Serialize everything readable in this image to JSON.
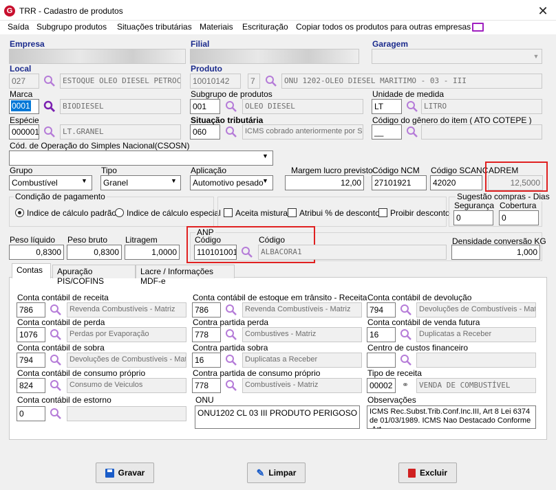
{
  "window": {
    "title": "TRR - Cadastro de produtos",
    "app_icon": "G"
  },
  "menu": {
    "items": [
      "Saída",
      "Subgrupo produtos",
      "Situações tributárias",
      "Materiais",
      "Escrituração",
      "Copiar todos os produtos para outras empresas"
    ]
  },
  "header": {
    "empresa_label": "Empresa",
    "filial_label": "Filial",
    "garagem_label": "Garagem",
    "local_label": "Local",
    "local_code": "027",
    "local_name": "ESTOQUE OLEO DIESEL PETROC",
    "produto_label": "Produto",
    "produto_code": "10010142",
    "produto_digit": "7",
    "produto_name": "ONU 1202-OLEO DIESEL MARITIMO - 03 - III",
    "marca_label": "Marca",
    "marca_code": "0001",
    "marca_name": "BIODIESEL",
    "subgrupo_label": "Subgrupo de produtos",
    "subgrupo_code": "001",
    "subgrupo_name": "OLEO DIESEL",
    "unidade_label": "Unidade de medida",
    "unidade_code": "LT",
    "unidade_name": "LITRO",
    "especie_label": "Espécie",
    "especie_code": "000001",
    "especie_name": "LT.GRANEL",
    "situacao_label": "Situação tributária",
    "situacao_code": "060",
    "situacao_name": "ICMS cobrado anteriormente por ST",
    "genero_label": "Código do gênero do item ( ATO COTEPE )",
    "genero_code": "__",
    "csosn_label": "Cód. de Operação do Simples Nacional(CSOSN)"
  },
  "classification": {
    "grupo_label": "Grupo",
    "grupo_value": "Combustível",
    "tipo_label": "Tipo",
    "tipo_value": "Granel",
    "aplicacao_label": "Aplicação",
    "aplicacao_value": "Automotivo pesado",
    "margem_label": "Margem lucro previsto",
    "margem_value": "12,00",
    "ncm_label": "Código NCM",
    "ncm_value": "27101921",
    "scanc_label": "Código SCANC",
    "scanc_value": "42020",
    "adrem_label": "ADREM",
    "adrem_value": "12,5000"
  },
  "payment": {
    "legend": "Condição de pagamento",
    "option1": "Indice de cálculo padrão",
    "option2": "Indice de cálculo especial",
    "aceita": "Aceita mistura",
    "atribui": "Atribui % de desconto",
    "proibir": "Proibir desconto"
  },
  "sugestao": {
    "legend": "Sugestão compras - Dias",
    "seguranca_label": "Segurança",
    "seguranca_value": "0",
    "cobertura_label": "Cobertura",
    "cobertura_value": "0"
  },
  "weights": {
    "peso_liquido_label": "Peso líquido",
    "peso_liquido_value": "0,8300",
    "peso_bruto_label": "Peso bruto",
    "peso_bruto_value": "0,8300",
    "litragem_label": "Litragem",
    "litragem_value": "1,0000",
    "anp_legend": "ANP",
    "anp_codigo_label": "Código",
    "anp_codigo_value": "110101001",
    "anp_codigo2_label": "Código",
    "anp_desc": "ALBACORA1",
    "densidade_label": "Densidade conversão KG",
    "densidade_value": "1,000"
  },
  "tabs": [
    "Contas",
    "Apuração PIS/COFINS",
    "Lacre / Informações MDF-e"
  ],
  "contas": {
    "receita_label": "Conta contábil de receita",
    "receita_code": "786",
    "receita_name": "Revenda Combustíveis - Matriz",
    "transito_label": "Conta contábil de estoque em trânsito - Receita",
    "transito_code": "786",
    "transito_name": "Revenda Combustíveis - Matriz",
    "devolucao_label": "Conta contábil de devolução",
    "devolucao_code": "794",
    "devolucao_name": "Devoluções de Combustíveis - Matr",
    "perda_label": "Conta contábil de perda",
    "perda_code": "1076",
    "perda_name": "Perdas por Evaporação",
    "cp_perda_label": "Contra partida  perda",
    "cp_perda_code": "778",
    "cp_perda_name": "Combustives - Matriz",
    "venda_futura_label": "Conta contábil de venda futura",
    "venda_futura_code": "16",
    "venda_futura_name": "Duplicatas a Receber",
    "sobra_label": "Conta contábil de sobra",
    "sobra_code": "794",
    "sobra_name": "Devoluções de Combustíveis - Matr",
    "cp_sobra_label": "Contra partida sobra",
    "cp_sobra_code": "16",
    "cp_sobra_name": "Duplicatas a Receber",
    "centro_label": "Centro de custos financeiro",
    "consumo_label": "Conta contábil de consumo próprio",
    "consumo_code": "824",
    "consumo_name": "Consumo de Veiculos",
    "cp_consumo_label": "Contra partida de consumo próprio",
    "cp_consumo_code": "778",
    "cp_consumo_name": "Combustíveis - Matriz",
    "tipo_receita_label": "Tipo de receita",
    "tipo_receita_code": "00002",
    "tipo_receita_name": "VENDA DE COMBUSTÍVEL",
    "estorno_label": "Conta contábil de estorno",
    "estorno_code": "0",
    "onu_label": "ONU",
    "onu_value": "ONU1202 CL 03 III PRODUTO PERIGOSO",
    "obs_label": "Observações",
    "obs_value": "ICMS Rec.Subst.Trib.Conf.Inc.III, Art 8 Lei 6374 de 01/03/1989. ICMS Nao Destacado Conforme .Art"
  },
  "buttons": {
    "gravar": "Gravar",
    "limpar": "Limpar",
    "excluir": "Excluir"
  },
  "colors": {
    "accent_blue": "#1a2a8c",
    "highlight_red": "#e02020",
    "search_purple": "#8a2be2",
    "selection_blue": "#0078d7"
  }
}
